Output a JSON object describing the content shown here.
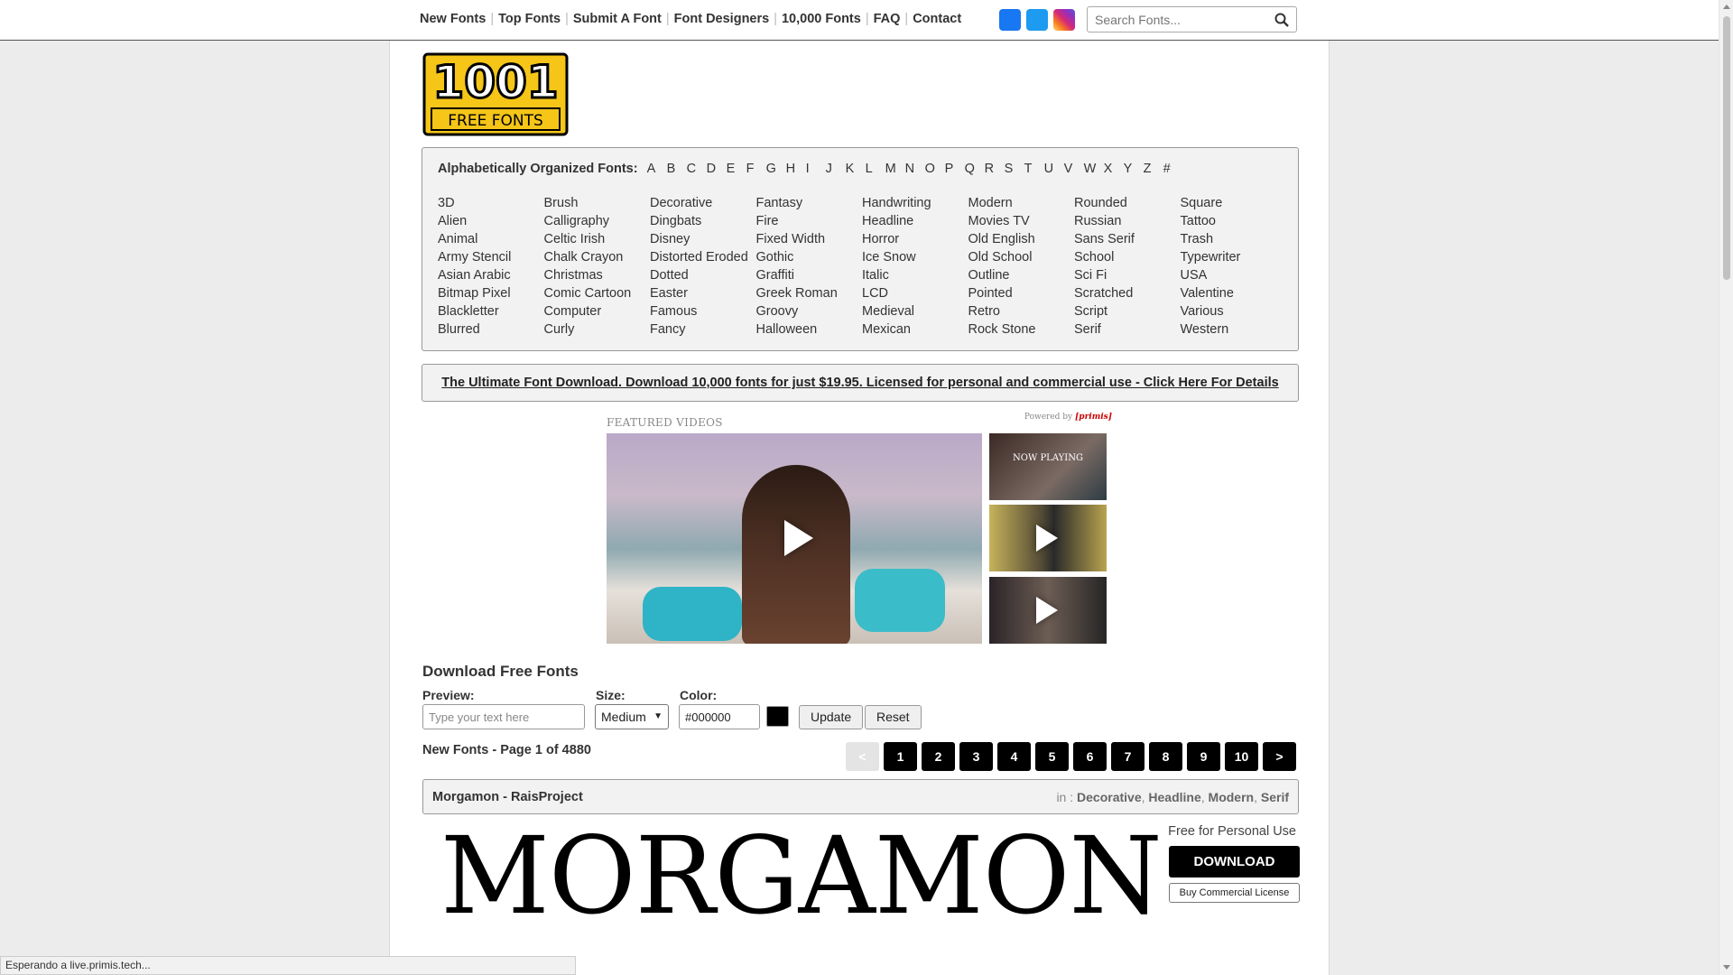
{
  "topnav": {
    "items": [
      "New Fonts",
      "Top Fonts",
      "Submit A Font",
      "Font Designers",
      "10,000 Fonts",
      "FAQ",
      "Contact"
    ]
  },
  "social": [
    "facebook-icon",
    "twitter-icon",
    "instagram-icon"
  ],
  "search": {
    "placeholder": "Search Fonts..."
  },
  "logo": {
    "text_top": "1001",
    "text_bottom": "FREE FONTS"
  },
  "categories": {
    "alpha_label": "Alphabetically Organized Fonts:",
    "letters": [
      "A",
      "B",
      "C",
      "D",
      "E",
      "F",
      "G",
      "H",
      "I",
      "J",
      "K",
      "L",
      "M",
      "N",
      "O",
      "P",
      "Q",
      "R",
      "S",
      "T",
      "U",
      "V",
      "W",
      "X",
      "Y",
      "Z",
      "#"
    ],
    "columns": [
      [
        "3D",
        "Alien",
        "Animal",
        "Army Stencil",
        "Asian Arabic",
        "Bitmap Pixel",
        "Blackletter",
        "Blurred"
      ],
      [
        "Brush",
        "Calligraphy",
        "Celtic Irish",
        "Chalk Crayon",
        "Christmas",
        "Comic Cartoon",
        "Computer",
        "Curly"
      ],
      [
        "Decorative",
        "Dingbats",
        "Disney",
        "Distorted Eroded",
        "Dotted",
        "Easter",
        "Famous",
        "Fancy"
      ],
      [
        "Fantasy",
        "Fire",
        "Fixed Width",
        "Gothic",
        "Graffiti",
        "Greek Roman",
        "Groovy",
        "Halloween"
      ],
      [
        "Handwriting",
        "Headline",
        "Horror",
        "Ice Snow",
        "Italic",
        "LCD",
        "Medieval",
        "Mexican"
      ],
      [
        "Modern",
        "Movies TV",
        "Old English",
        "Old School",
        "Outline",
        "Pointed",
        "Retro",
        "Rock Stone"
      ],
      [
        "Rounded",
        "Russian",
        "Sans Serif",
        "School",
        "Sci Fi",
        "Scratched",
        "Script",
        "Serif"
      ],
      [
        "Square",
        "Tattoo",
        "Trash",
        "Typewriter",
        "USA",
        "Valentine",
        "Various",
        "Western"
      ]
    ]
  },
  "promo": {
    "text": "The Ultimate Font Download. Download 10,000 fonts for just $19.95. Licensed for personal and commercial use - Click Here For Details"
  },
  "video": {
    "label": "FEATURED VIDEOS",
    "powered_by": "Powered by",
    "brand": "[primis]",
    "now_playing": "NOW PLAYING"
  },
  "download": {
    "title": "Download Free Fonts",
    "preview_label": "Preview:",
    "preview_placeholder": "Type your text here",
    "size_label": "Size:",
    "size_value": "Medium",
    "color_label": "Color:",
    "color_value": "#000000",
    "update_label": "Update",
    "reset_label": "Reset"
  },
  "listing": {
    "page_info": "New Fonts - Page 1 of 4880",
    "pages": [
      "<",
      "1",
      "2",
      "3",
      "4",
      "5",
      "6",
      "7",
      "8",
      "9",
      "10",
      ">"
    ]
  },
  "font": {
    "name": "Morgamon",
    "designer": "RaisProject",
    "in_label": "in :",
    "categories": [
      "Decorative",
      "Headline",
      "Modern",
      "Serif"
    ],
    "specimen": "MORGAMON",
    "license_note": "Free for Personal Use",
    "download_label": "DOWNLOAD",
    "commercial_label": "Buy Commercial License"
  },
  "status": {
    "text": "Esperando a live.primis.tech..."
  },
  "colors": {
    "black": "#000000",
    "panel": "#f2f2f2",
    "facebook": "#1877f2",
    "twitter": "#1d9bf0"
  }
}
